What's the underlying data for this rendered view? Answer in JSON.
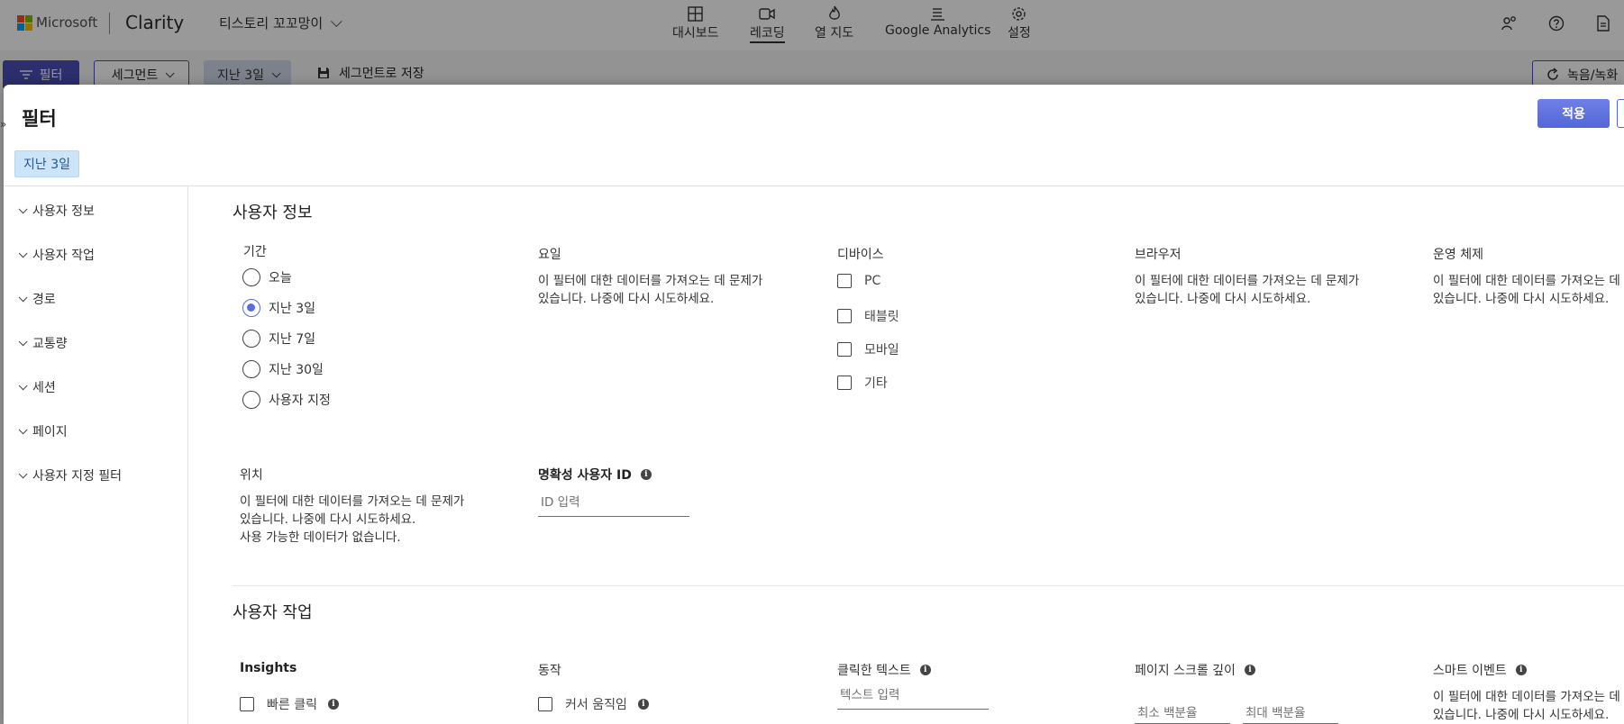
{
  "colors": {
    "accent": "#4a4eb8",
    "apply_button": "#5467d6",
    "chip_bg": "#cde3f7",
    "radio_selected": "#5b6be0",
    "ms_red": "#f25022",
    "ms_green": "#7fba00",
    "ms_blue": "#00a4ef",
    "ms_yellow": "#ffb900"
  },
  "topbar": {
    "ms_word": "Microsoft",
    "brand": "Clarity",
    "project": "티스토리 꼬꼬망이",
    "nav": [
      {
        "label": "대시보드",
        "icon": "dashboard-icon"
      },
      {
        "label": "레코딩",
        "icon": "video-icon",
        "active": true
      },
      {
        "label": "열 지도",
        "icon": "flame-icon"
      },
      {
        "label": "Google Analytics",
        "icon": "analytics-icon"
      },
      {
        "label": "설정",
        "icon": "gear-icon"
      }
    ],
    "right_icons": [
      "share-people-icon",
      "help-icon",
      "document-icon"
    ]
  },
  "subbar": {
    "filter_label": "필터",
    "segment_label": "세그먼트",
    "period_label": "지난 3일",
    "save_label": "세그먼트로 저장",
    "recording_label": "녹음/녹화"
  },
  "panel": {
    "title": "필터",
    "apply_label": "적용",
    "active_chip": "지난 3일",
    "edge_glyph": "»",
    "sidebar": [
      "사용자 정보",
      "사용자 작업",
      "경로",
      "교통량",
      "세션",
      "페이지",
      "사용자 지정 필터"
    ],
    "user_info": {
      "title": "사용자 정보",
      "period": {
        "label": "기간",
        "options": [
          "오늘",
          "지난 3일",
          "지난 7일",
          "지난 30일",
          "사용자 지정"
        ],
        "selected": "지난 3일"
      },
      "weekday": {
        "label": "요일",
        "error": "이 필터에 대한 데이터를 가져오는 데 문제가 있습니다. 나중에 다시 시도하세요."
      },
      "device": {
        "label": "디바이스",
        "options": [
          "PC",
          "태블릿",
          "모바일",
          "기타"
        ]
      },
      "browser": {
        "label": "브라우저",
        "error": "이 필터에 대한 데이터를 가져오는 데 문제가 있습니다. 나중에 다시 시도하세요."
      },
      "os": {
        "label": "운영 체제",
        "error": "이 필터에 대한 데이터를 가져오는 데 문제가 있습니다. 나중에 다시 시도하세요."
      },
      "location": {
        "label": "위치",
        "error": "이 필터에 대한 데이터를 가져오는 데 문제가 있습니다. 나중에 다시 시도하세요.",
        "empty": "사용 가능한 데이터가 없습니다."
      },
      "clarity_id": {
        "label": "명확성 사용자 ID",
        "placeholder": "ID 입력"
      }
    },
    "user_actions": {
      "title": "사용자 작업",
      "insights": {
        "label": "Insights",
        "first_option": "빠른 클릭"
      },
      "behavior": {
        "label": "동작",
        "first_option": "커서 움직임"
      },
      "clicked_text": {
        "label": "클릭한 텍스트",
        "placeholder": "텍스트 입력"
      },
      "scroll_depth": {
        "label": "페이지 스크롤 깊이",
        "min_placeholder": "최소 백분율",
        "max_placeholder": "최대 백분율"
      },
      "smart_events": {
        "label": "스마트 이벤트",
        "error": "이 필터에 대한 데이터를 가져오는 데 문제가 있습니다. 나중에 다시 시도하세요."
      }
    }
  }
}
